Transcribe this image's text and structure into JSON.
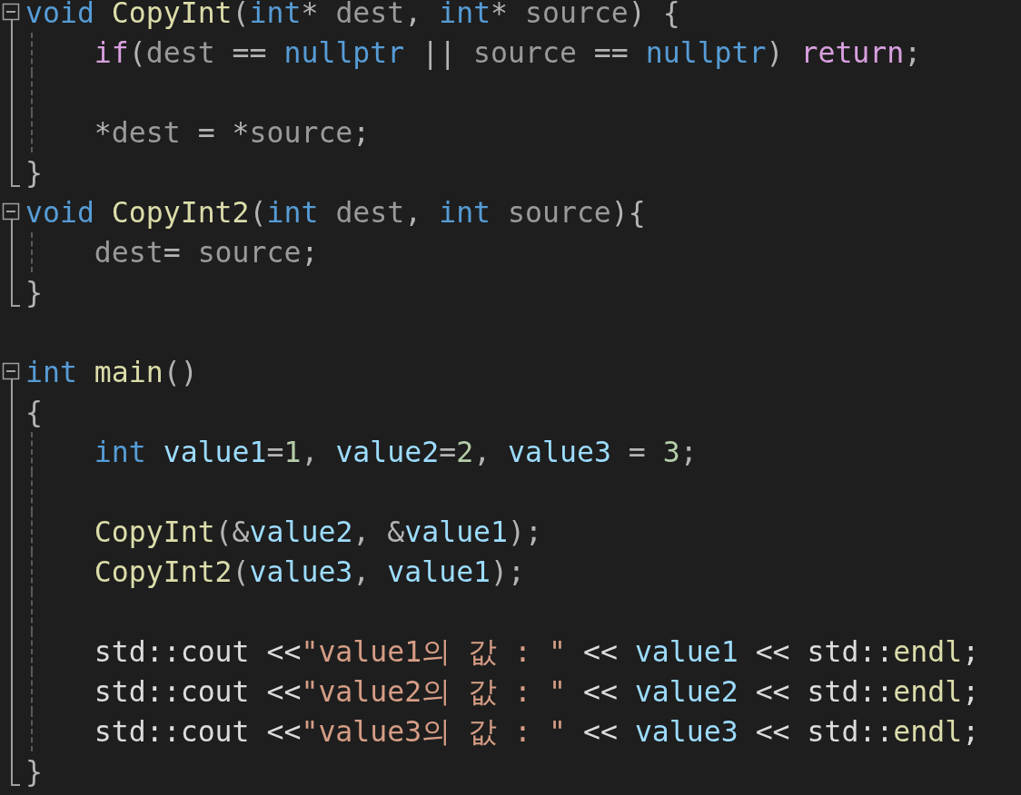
{
  "editor": {
    "lines": [
      {
        "kind": "start",
        "expanded": true,
        "tokens": [
          {
            "text": "void ",
            "kind": "kw"
          },
          {
            "text": "CopyInt",
            "kind": "fn"
          },
          {
            "text": "(",
            "kind": "punc"
          },
          {
            "text": "int",
            "kind": "kw"
          },
          {
            "text": "* ",
            "kind": "punc"
          },
          {
            "text": "dest",
            "kind": "param"
          },
          {
            "text": ", ",
            "kind": "punc"
          },
          {
            "text": "int",
            "kind": "kw"
          },
          {
            "text": "* ",
            "kind": "punc"
          },
          {
            "text": "source",
            "kind": "param"
          },
          {
            "text": ") {",
            "kind": "punc"
          }
        ]
      },
      {
        "kind": "body",
        "guide": true,
        "tokens": [
          {
            "text": "    if",
            "kind": "ctrl"
          },
          {
            "text": "(",
            "kind": "punc"
          },
          {
            "text": "dest",
            "kind": "param"
          },
          {
            "text": " == ",
            "kind": "punc"
          },
          {
            "text": "nullptr",
            "kind": "kw"
          },
          {
            "text": " || ",
            "kind": "punc"
          },
          {
            "text": "source",
            "kind": "param"
          },
          {
            "text": " == ",
            "kind": "punc"
          },
          {
            "text": "nullptr",
            "kind": "kw"
          },
          {
            "text": ") ",
            "kind": "punc"
          },
          {
            "text": "return",
            "kind": "ctrl"
          },
          {
            "text": ";",
            "kind": "punc"
          }
        ]
      },
      {
        "kind": "body",
        "guide": true
      },
      {
        "kind": "body",
        "guide": true,
        "tokens": [
          {
            "text": "    *",
            "kind": "punc"
          },
          {
            "text": "dest",
            "kind": "param"
          },
          {
            "text": " = *",
            "kind": "punc"
          },
          {
            "text": "source",
            "kind": "param"
          },
          {
            "text": ";",
            "kind": "punc"
          }
        ]
      },
      {
        "kind": "end",
        "tokens": [
          {
            "text": "}",
            "kind": "punc"
          }
        ]
      },
      {
        "kind": "start",
        "expanded": true,
        "tokens": [
          {
            "text": "void ",
            "kind": "kw"
          },
          {
            "text": "CopyInt2",
            "kind": "fn"
          },
          {
            "text": "(",
            "kind": "punc"
          },
          {
            "text": "int ",
            "kind": "kw"
          },
          {
            "text": "dest",
            "kind": "param"
          },
          {
            "text": ", ",
            "kind": "punc"
          },
          {
            "text": "int ",
            "kind": "kw"
          },
          {
            "text": "source",
            "kind": "param"
          },
          {
            "text": "){",
            "kind": "punc"
          }
        ]
      },
      {
        "kind": "body",
        "guide": true,
        "tokens": [
          {
            "text": "    dest",
            "kind": "param"
          },
          {
            "text": "= ",
            "kind": "punc"
          },
          {
            "text": "source",
            "kind": "param"
          },
          {
            "text": ";",
            "kind": "punc"
          }
        ]
      },
      {
        "kind": "end",
        "tokens": [
          {
            "text": "}",
            "kind": "punc"
          }
        ]
      },
      {
        "kind": "plain"
      },
      {
        "kind": "start",
        "expanded": true,
        "tokens": [
          {
            "text": "int ",
            "kind": "kw"
          },
          {
            "text": "main",
            "kind": "fn"
          },
          {
            "text": "()",
            "kind": "punc"
          }
        ]
      },
      {
        "kind": "body",
        "tokens": [
          {
            "text": "{",
            "kind": "punc"
          }
        ]
      },
      {
        "kind": "body",
        "guide": true,
        "tokens": [
          {
            "text": "    int ",
            "kind": "kw"
          },
          {
            "text": "value1",
            "kind": "var"
          },
          {
            "text": "=",
            "kind": "punc"
          },
          {
            "text": "1",
            "kind": "num"
          },
          {
            "text": ", ",
            "kind": "punc"
          },
          {
            "text": "value2",
            "kind": "var"
          },
          {
            "text": "=",
            "kind": "punc"
          },
          {
            "text": "2",
            "kind": "num"
          },
          {
            "text": ", ",
            "kind": "punc"
          },
          {
            "text": "value3",
            "kind": "var"
          },
          {
            "text": " = ",
            "kind": "punc"
          },
          {
            "text": "3",
            "kind": "num"
          },
          {
            "text": ";",
            "kind": "punc"
          }
        ]
      },
      {
        "kind": "body",
        "guide": true
      },
      {
        "kind": "body",
        "guide": true,
        "tokens": [
          {
            "text": "    CopyInt",
            "kind": "fn"
          },
          {
            "text": "(&",
            "kind": "punc"
          },
          {
            "text": "value2",
            "kind": "var"
          },
          {
            "text": ", &",
            "kind": "punc"
          },
          {
            "text": "value1",
            "kind": "var"
          },
          {
            "text": ");",
            "kind": "punc"
          }
        ]
      },
      {
        "kind": "body",
        "guide": true,
        "tokens": [
          {
            "text": "    CopyInt2",
            "kind": "fn"
          },
          {
            "text": "(",
            "kind": "punc"
          },
          {
            "text": "value3",
            "kind": "var"
          },
          {
            "text": ", ",
            "kind": "punc"
          },
          {
            "text": "value1",
            "kind": "var"
          },
          {
            "text": ");",
            "kind": "punc"
          }
        ]
      },
      {
        "kind": "body",
        "guide": true
      },
      {
        "kind": "body",
        "guide": true,
        "tokens": [
          {
            "text": "    std::cout <<",
            "kind": "plain"
          },
          {
            "text": "\"value1의 값 : \"",
            "kind": "str"
          },
          {
            "text": " << ",
            "kind": "plain"
          },
          {
            "text": "value1",
            "kind": "var"
          },
          {
            "text": " << std::",
            "kind": "plain"
          },
          {
            "text": "endl",
            "kind": "fn"
          },
          {
            "text": ";",
            "kind": "plain"
          }
        ]
      },
      {
        "kind": "body",
        "guide": true,
        "tokens": [
          {
            "text": "    std::cout <<",
            "kind": "plain"
          },
          {
            "text": "\"value2의 값 : \"",
            "kind": "str"
          },
          {
            "text": " << ",
            "kind": "plain"
          },
          {
            "text": "value2",
            "kind": "var"
          },
          {
            "text": " << std::",
            "kind": "plain"
          },
          {
            "text": "endl",
            "kind": "fn"
          },
          {
            "text": ";",
            "kind": "plain"
          }
        ]
      },
      {
        "kind": "body",
        "guide": true,
        "tokens": [
          {
            "text": "    std::cout <<",
            "kind": "plain"
          },
          {
            "text": "\"value3의 값 : \"",
            "kind": "str"
          },
          {
            "text": " << ",
            "kind": "plain"
          },
          {
            "text": "value3",
            "kind": "var"
          },
          {
            "text": " << std::",
            "kind": "plain"
          },
          {
            "text": "endl",
            "kind": "fn"
          },
          {
            "text": ";",
            "kind": "plain"
          }
        ]
      },
      {
        "kind": "end",
        "tokens": [
          {
            "text": "}",
            "kind": "punc"
          }
        ]
      }
    ]
  }
}
